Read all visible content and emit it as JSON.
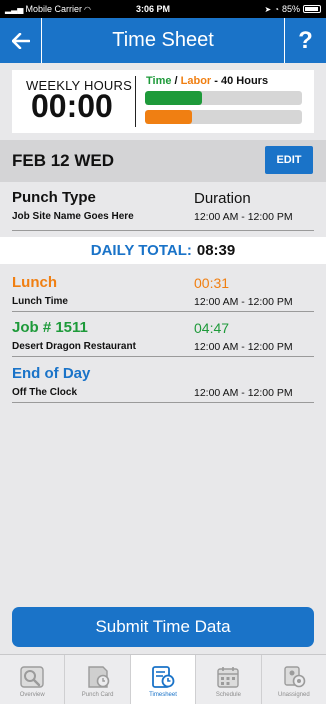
{
  "status": {
    "carrier": "Mobile Carrier",
    "time": "3:06 PM",
    "battery": "85%"
  },
  "header": {
    "back": "←",
    "title": "Time Sheet",
    "help": "?"
  },
  "weekly": {
    "label": "WEEKLY HOURS",
    "value": "00:00",
    "legend_time": "Time",
    "legend_sep": " / ",
    "legend_labor": "Labor",
    "legend_rest": " - 40 Hours",
    "time_fraction": 0.36,
    "labor_fraction": 0.3,
    "time_color": "#1e9a3a",
    "labor_color": "#f07f12"
  },
  "day": {
    "date": "FEB 12 WED",
    "edit": "EDIT"
  },
  "header_row": {
    "title": "Punch Type",
    "sub": "Job Site Name Goes Here",
    "dur": "Duration",
    "range": "12:00 AM - 12:00 PM"
  },
  "daily_total": {
    "label": "DAILY TOTAL:",
    "value": "08:39"
  },
  "entries": [
    {
      "title": "Lunch",
      "sub": "Lunch Time",
      "dur": "00:31",
      "range": "12:00 AM - 12:00 PM",
      "color": "#f07f12"
    },
    {
      "title": "Job # 1511",
      "sub": "Desert Dragon Restaurant",
      "dur": "04:47",
      "range": "12:00 AM - 12:00 PM",
      "color": "#1e9a3a"
    },
    {
      "title": "End of Day",
      "sub": "Off The Clock",
      "dur": "",
      "range": "12:00 AM - 12:00 PM",
      "color": "#1a73c8"
    }
  ],
  "submit": "Submit Time Data",
  "tabs": [
    {
      "label": "Overview",
      "icon": "overview-icon"
    },
    {
      "label": "Punch Card",
      "icon": "punch-card-icon"
    },
    {
      "label": "Timesheet",
      "icon": "timesheet-icon"
    },
    {
      "label": "Schedule",
      "icon": "schedule-icon"
    },
    {
      "label": "Unassigned",
      "icon": "unassigned-icon"
    }
  ]
}
